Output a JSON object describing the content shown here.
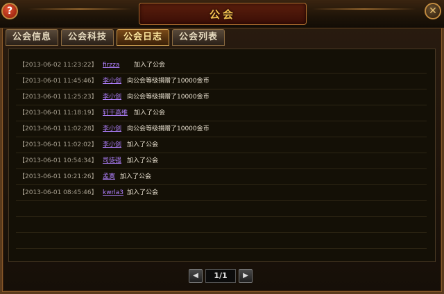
{
  "window": {
    "title": "公会",
    "help_icon": "?",
    "close_icon": "✕"
  },
  "tabs": [
    {
      "label": "公会信息",
      "active": false
    },
    {
      "label": "公会科技",
      "active": false
    },
    {
      "label": "公会日志",
      "active": true
    },
    {
      "label": "公会列表",
      "active": false
    }
  ],
  "log": [
    {
      "time": "【2013-06-02 11:23:22】",
      "name": "firzza",
      "action": "加入了公会"
    },
    {
      "time": "【2013-06-01 11:45:46】",
      "name": "李小剑",
      "action": "向公会等级捐赠了10000金币"
    },
    {
      "time": "【2013-06-01 11:25:23】",
      "name": "李小剑",
      "action": "向公会等级捐赠了10000金币"
    },
    {
      "time": "【2013-06-01 11:18:19】",
      "name": "轩干高维",
      "action": "加入了公会"
    },
    {
      "time": "【2013-06-01 11:02:28】",
      "name": "李小剑",
      "action": "向公会等级捐赠了10000金币"
    },
    {
      "time": "【2013-06-01 11:02:02】",
      "name": "李小剑",
      "action": "加入了公会"
    },
    {
      "time": "【2013-06-01 10:54:34】",
      "name": "司徒强",
      "action": "加入了公会"
    },
    {
      "time": "【2013-06-01 10:21:26】",
      "name": "孟寞",
      "action": "加入了公会"
    },
    {
      "time": "【2013-06-01 08:45:46】",
      "name": "kwrla3",
      "action": "加入了公会"
    }
  ],
  "pagination": {
    "prev_icon": "◀",
    "next_icon": "▶",
    "page_display": "1/1"
  },
  "colors": {
    "title": "#f0c050",
    "player_name": "#b080ff",
    "active_tab": "#ffe9a0"
  }
}
